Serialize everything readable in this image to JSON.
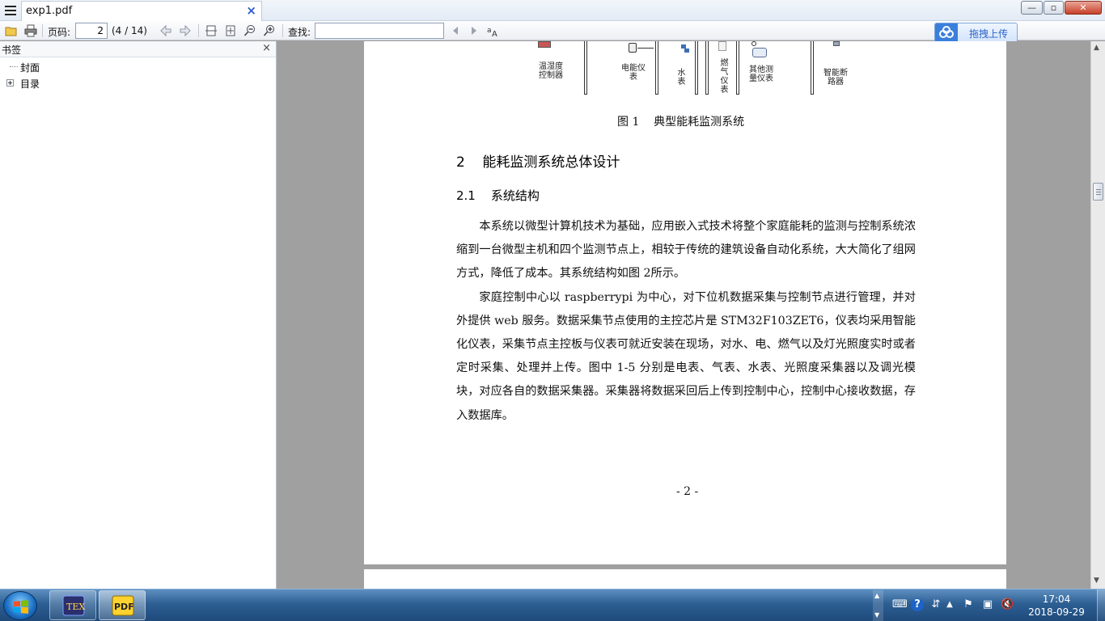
{
  "window": {
    "tab_title": "exp1.pdf"
  },
  "toolbar": {
    "page_label": "页码:",
    "page_value": "2",
    "page_total": "(4 / 14)",
    "find_label": "查找:",
    "find_value": "",
    "upload_label": "拖拽上传"
  },
  "sidebar": {
    "title": "书签",
    "items": [
      {
        "label": "封面",
        "expandable": false
      },
      {
        "label": "目录",
        "expandable": true
      }
    ]
  },
  "document": {
    "figure_labels": [
      "温湿度控制器",
      "电能仪表",
      "水表",
      "燃气仪表",
      "其他测量仪表",
      "智能断路器"
    ],
    "caption": "图 1    典型能耗监测系统",
    "section_heading": "2    能耗监测系统总体设计",
    "subsection_heading": "2.1    系统结构",
    "paragraphs": [
      "本系统以微型计算机技术为基础，应用嵌入式技术将整个家庭能耗的监测与控制系统浓缩到一台微型主机和四个监测节点上，相较于传统的建筑设备自动化系统，大大简化了组网方式，降低了成本。其系统结构如图 2所示。",
      "家庭控制中心以 raspberrypi 为中心，对下位机数据采集与控制节点进行管理，并对外提供 web 服务。数据采集节点使用的主控芯片是 STM32F103ZET6，仪表均采用智能化仪表，采集节点主控板与仪表可就近安装在现场，对水、电、燃气以及灯光照度实时或者定时采集、处理并上传。图中 1-5 分别是电表、气表、水表、光照度采集器以及调光模块，对应各自的数据采集器。采集器将数据采回后上传到控制中心，控制中心接收数据，存入数据库。"
    ],
    "page_number": "- 2 -"
  },
  "taskbar": {
    "time": "17:04",
    "date": "2018-09-29"
  }
}
